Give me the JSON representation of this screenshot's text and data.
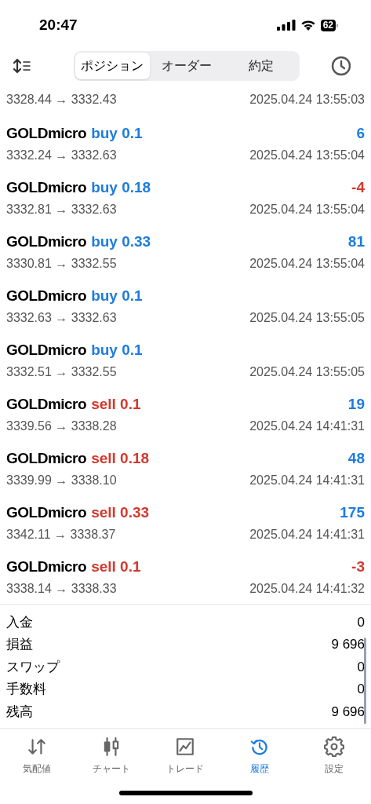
{
  "status_bar": {
    "time": "20:47",
    "battery": "62"
  },
  "tabs": [
    {
      "label": "ポジション",
      "selected": true
    },
    {
      "label": "オーダー",
      "selected": false
    },
    {
      "label": "約定",
      "selected": false
    }
  ],
  "trades": [
    {
      "prices": "3328.44 → 3332.43",
      "time": "2025.04.24 13:55:03"
    },
    {
      "symbol": "GOLDmicro",
      "side": "buy",
      "volume": "0.1",
      "profit": "6",
      "color": "#1c7ce0",
      "prices": "3332.24 → 3332.63",
      "time": "2025.04.24 13:55:04"
    },
    {
      "symbol": "GOLDmicro",
      "side": "buy",
      "volume": "0.18",
      "profit": "-4",
      "color": "#d4382c",
      "prices": "3332.81 → 3332.63",
      "time": "2025.04.24 13:55:04"
    },
    {
      "symbol": "GOLDmicro",
      "side": "buy",
      "volume": "0.33",
      "profit": "81",
      "color": "#1c7ce0",
      "prices": "3330.81 → 3332.55",
      "time": "2025.04.24 13:55:04"
    },
    {
      "symbol": "GOLDmicro",
      "side": "buy",
      "volume": "0.1",
      "prices": "3332.63 → 3332.63",
      "time": "2025.04.24 13:55:05"
    },
    {
      "symbol": "GOLDmicro",
      "side": "buy",
      "volume": "0.1",
      "prices": "3332.51 → 3332.55",
      "time": "2025.04.24 13:55:05"
    },
    {
      "symbol": "GOLDmicro",
      "side": "sell",
      "volume": "0.1",
      "profit": "19",
      "color": "#1c7ce0",
      "prices": "3339.56 → 3338.28",
      "time": "2025.04.24 14:41:31"
    },
    {
      "symbol": "GOLDmicro",
      "side": "sell",
      "volume": "0.18",
      "profit": "48",
      "color": "#1c7ce0",
      "prices": "3339.99 → 3338.10",
      "time": "2025.04.24 14:41:31"
    },
    {
      "symbol": "GOLDmicro",
      "side": "sell",
      "volume": "0.33",
      "profit": "175",
      "color": "#1c7ce0",
      "prices": "3342.11 → 3338.37",
      "time": "2025.04.24 14:41:31"
    },
    {
      "symbol": "GOLDmicro",
      "side": "sell",
      "volume": "0.1",
      "profit": "-3",
      "color": "#d4382c",
      "prices": "3338.14 → 3338.33",
      "time": "2025.04.24 14:41:32"
    }
  ],
  "summary": [
    {
      "label": "入金",
      "value": "0"
    },
    {
      "label": "損益",
      "value": "9 696"
    },
    {
      "label": "スワップ",
      "value": "0"
    },
    {
      "label": "手数料",
      "value": "0"
    },
    {
      "label": "残高",
      "value": "9 696"
    }
  ],
  "nav": [
    {
      "kind": "quotes",
      "label": "気配値",
      "selected": false
    },
    {
      "kind": "chart",
      "label": "チャート",
      "selected": false
    },
    {
      "kind": "trade",
      "label": "トレード",
      "selected": false
    },
    {
      "kind": "history",
      "label": "履歴",
      "selected": true
    },
    {
      "kind": "settings",
      "label": "設定",
      "selected": false
    }
  ]
}
